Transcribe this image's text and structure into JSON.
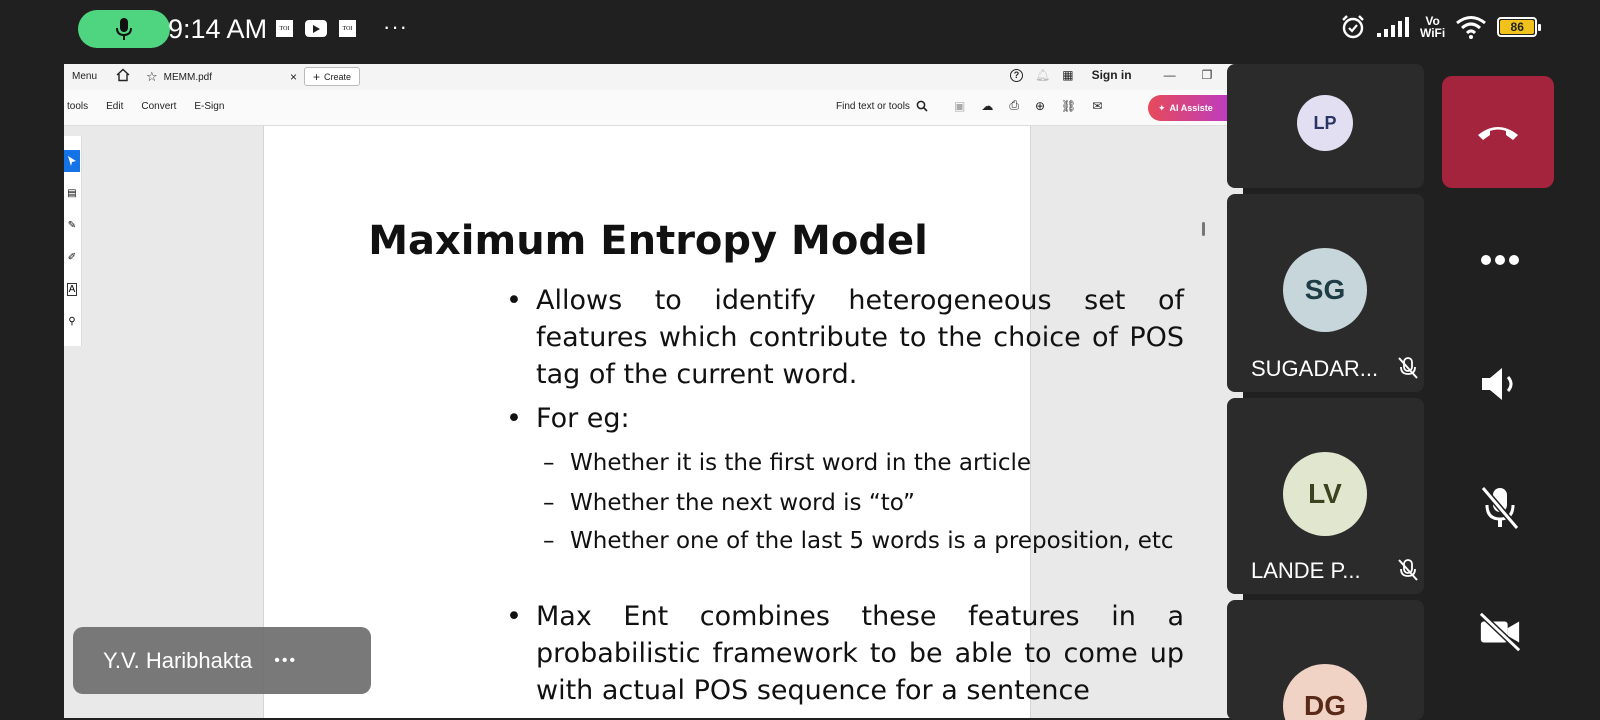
{
  "status_bar": {
    "time": "9:14 AM",
    "notification_icons": [
      "toi-icon",
      "youtube-icon",
      "toi-icon"
    ],
    "more": "···",
    "network_label_top": "Vo",
    "network_label_bottom": "WiFi",
    "battery_level": "86"
  },
  "acrobat": {
    "titlebar": {
      "menu_label": "Menu",
      "tab_name": "MEMM.pdf",
      "tab_close": "×",
      "create_label": "Create",
      "sign_in_label": "Sign in"
    },
    "toolbar": {
      "items": [
        "tools",
        "Edit",
        "Convert",
        "E-Sign"
      ],
      "find_label": "Find text or tools",
      "ai_label": "AI Assiste"
    }
  },
  "slide": {
    "title": "Maximum Entropy Model",
    "bullets": [
      "Allows to identify heterogeneous set of features which contribute to the choice of POS tag of the current word.",
      "For eg:",
      "Max Ent combines these features in a probabilistic framework to be able to come up with actual POS  sequence for a sentence"
    ],
    "sub_bullets": [
      "Whether it is the first word in the article",
      "Whether the next word is “to”",
      "Whether one of the last 5 words is a preposition, etc"
    ],
    "bullet_symbol": "•",
    "dash_symbol": "–"
  },
  "presenter": {
    "name": "Y.V. Haribhakta",
    "more": "•••"
  },
  "participants": [
    {
      "initials": "LP",
      "name": ""
    },
    {
      "initials": "SG",
      "name": "SUGADAR..."
    },
    {
      "initials": "LV",
      "name": "LANDE P..."
    },
    {
      "initials": "DG",
      "name": ""
    }
  ],
  "colors": {
    "mic_active": "#4fd57f",
    "hangup": "#a3243c",
    "acrobat_blue": "#1473e6",
    "avatar_lp": "#e3dff2",
    "avatar_sg": "#c7d6db",
    "avatar_lv": "#e1e6cf",
    "avatar_dg": "#f1d3c6"
  }
}
